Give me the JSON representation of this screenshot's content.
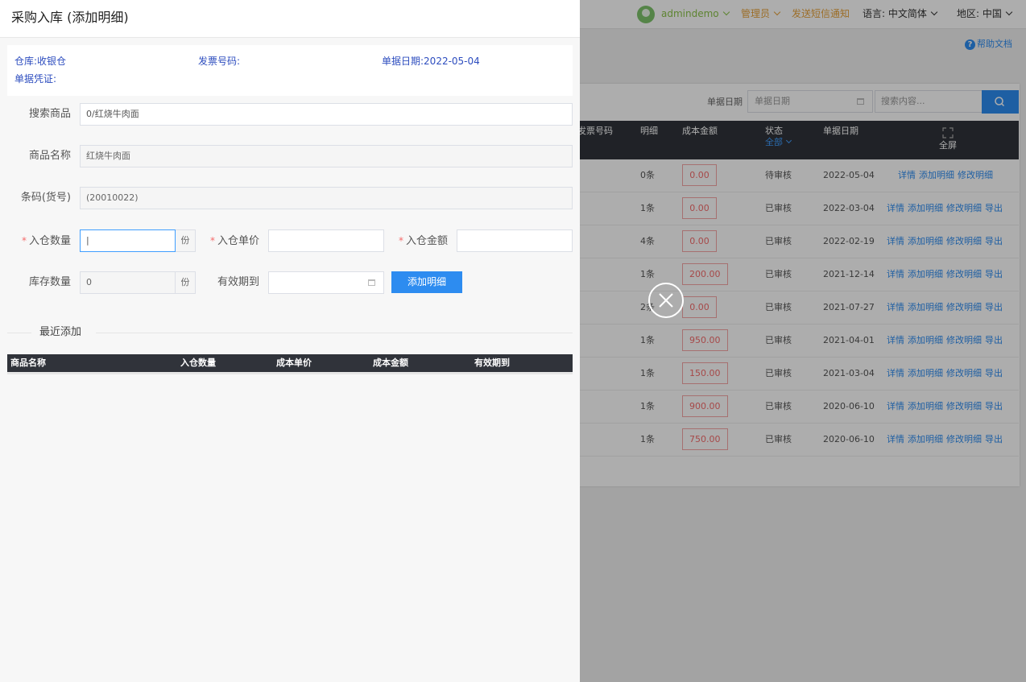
{
  "topbar": {
    "username": "admindemo",
    "role": "管理员",
    "sms": "发送短信通知",
    "lang_label": "语言:",
    "lang_value": "中文简体",
    "region_label": "地区:",
    "region_value": "中国"
  },
  "help": "帮助文档",
  "filter": {
    "date_label": "单据日期",
    "date_placeholder": "单据日期",
    "search_placeholder": "搜索内容..."
  },
  "bg_table": {
    "headers": {
      "invoice": "发票号码",
      "detail": "明细",
      "cost": "成本金额",
      "status": "状态",
      "status_filter": "全部",
      "date": "单据日期",
      "fullscreen": "全屏"
    },
    "rows": [
      {
        "detail": "0条",
        "cost": "0.00",
        "status": "待审核",
        "date": "2022-05-04",
        "actions": [
          "详情",
          "添加明细",
          "修改明细"
        ]
      },
      {
        "detail": "1条",
        "cost": "0.00",
        "status": "已审核",
        "date": "2022-03-04",
        "actions": [
          "详情",
          "添加明细",
          "修改明细",
          "导出"
        ]
      },
      {
        "detail": "4条",
        "cost": "0.00",
        "status": "已审核",
        "date": "2022-02-19",
        "actions": [
          "详情",
          "添加明细",
          "修改明细",
          "导出"
        ]
      },
      {
        "detail": "1条",
        "cost": "200.00",
        "status": "已审核",
        "date": "2021-12-14",
        "actions": [
          "详情",
          "添加明细",
          "修改明细",
          "导出"
        ]
      },
      {
        "detail": "2条",
        "cost": "0.00",
        "status": "已审核",
        "date": "2021-07-27",
        "actions": [
          "详情",
          "添加明细",
          "修改明细",
          "导出"
        ]
      },
      {
        "detail": "1条",
        "cost": "950.00",
        "status": "已审核",
        "date": "2021-04-01",
        "actions": [
          "详情",
          "添加明细",
          "修改明细",
          "导出"
        ]
      },
      {
        "detail": "1条",
        "cost": "150.00",
        "status": "已审核",
        "date": "2021-03-04",
        "actions": [
          "详情",
          "添加明细",
          "修改明细",
          "导出"
        ]
      },
      {
        "detail": "1条",
        "cost": "900.00",
        "status": "已审核",
        "date": "2020-06-10",
        "actions": [
          "详情",
          "添加明细",
          "修改明细",
          "导出"
        ]
      },
      {
        "detail": "1条",
        "cost": "750.00",
        "status": "已审核",
        "date": "2020-06-10",
        "actions": [
          "详情",
          "添加明细",
          "修改明细",
          "导出"
        ]
      }
    ]
  },
  "drawer": {
    "title": "采购入库 (添加明细)",
    "info": {
      "warehouse": "仓库:收银仓",
      "invoice": "发票号码:",
      "date": "单据日期:2022-05-04",
      "voucher": "单据凭证:"
    },
    "form": {
      "search_label": "搜索商品",
      "search_value": "0/红烧牛肉面",
      "name_label": "商品名称",
      "name_value": "红烧牛肉面",
      "barcode_label": "条码(货号)",
      "barcode_value": "(20010022)",
      "qty_label": "入仓数量",
      "qty_value": "|",
      "unit": "份",
      "price_label": "入仓单价",
      "amount_label": "入仓金额",
      "stock_label": "库存数量",
      "stock_value": "0",
      "expiry_label": "有效期到",
      "add_button": "添加明细",
      "required_mark": "*"
    },
    "recent": {
      "title": "最近添加",
      "headers": [
        "商品名称",
        "入仓数量",
        "成本单价",
        "成本金额",
        "有效期到"
      ]
    }
  },
  "colors": {
    "primary": "#2d8cf0",
    "header_dark": "#30333a",
    "danger": "#f56c6c",
    "orange": "#e6a23c",
    "green": "#8bc34a"
  }
}
